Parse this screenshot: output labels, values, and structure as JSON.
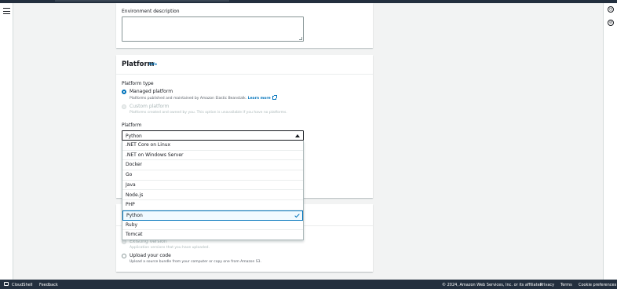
{
  "environment": {
    "description_label": "Environment description",
    "description_value": ""
  },
  "platform": {
    "title": "Platform",
    "info_label": "Info",
    "type_label": "Platform type",
    "managed_title": "Managed platform",
    "managed_desc": "Platforms published and maintained by Amazon Elastic Beanstalk.",
    "learn_more": "Learn more",
    "custom_title": "Custom platform",
    "custom_desc": "Platforms created and owned by you. This option is unavailable if you have no platforms.",
    "platform_label": "Platform",
    "selected": "Python",
    "options": [
      ".NET Core on Linux",
      ".NET on Windows Server",
      "Docker",
      "Go",
      "Java",
      "Node.js",
      "PHP",
      "Python",
      "Ruby",
      "Tomcat"
    ]
  },
  "code": {
    "existing_title": "Existing version",
    "existing_desc": "Application versions that you have uploaded.",
    "upload_title": "Upload your code",
    "upload_desc": "Upload a source bundle from your computer or copy one from Amazon S3."
  },
  "footer": {
    "cloudshell": "CloudShell",
    "feedback": "Feedback",
    "copyright": "© 2024, Amazon Web Services, Inc. or its affiliates.",
    "privacy": "Privacy",
    "terms": "Terms",
    "cookie": "Cookie preferences"
  },
  "colors": {
    "accent": "#0073bb",
    "nav_dark": "#232f3e"
  },
  "icons": {
    "menu": "hamburger-icon",
    "clock": "recent-icon",
    "feedback": "feedback-icon",
    "external": "external-link-icon",
    "check": "checkmark-icon"
  }
}
